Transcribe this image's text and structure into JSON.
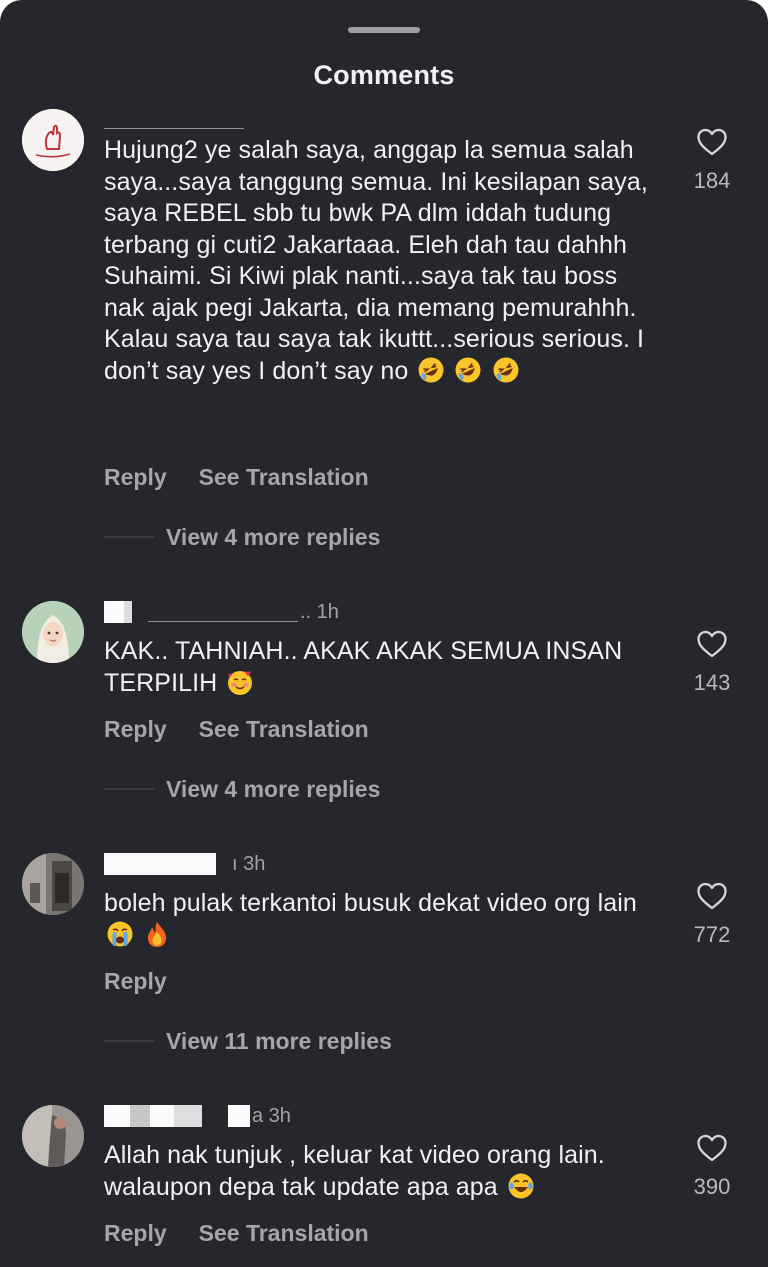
{
  "header": {
    "title": "Comments"
  },
  "comments": [
    {
      "time": "",
      "text": "Hujung2 ye salah saya, anggap la semua salah saya...saya tanggung semua. Ini kesilapan saya, saya REBEL sbb tu bwk PA dlm iddah tudung terbang gi cuti2 Jakartaaa. Eleh dah tau dahhh Suhaimi. Si Kiwi plak nanti...saya tak tau boss nak ajak pegi Jakarta, dia memang pemurahhh. Kalau saya tau saya tak ikuttt...serious serious. I don’t say yes I don’t say no",
      "emojis": [
        "rolling-laughing-emoji",
        "rolling-laughing-emoji",
        "rolling-laughing-emoji"
      ],
      "likes": "184",
      "reply_label": "Reply",
      "translate_label": "See Translation",
      "view_replies": "View 4 more replies"
    },
    {
      "username_visible": ".. 1h",
      "text": "KAK.. TAHNIAH.. AKAK AKAK SEMUA INSAN TERPILIH",
      "emojis": [
        "smiling-hearts-emoji"
      ],
      "likes": "143",
      "reply_label": "Reply",
      "translate_label": "See Translation",
      "view_replies": "View 4 more replies"
    },
    {
      "username_visible": "ı 3h",
      "text": "boleh pulak terkantoi busuk dekat video org lain",
      "emojis": [
        "loudly-crying-emoji",
        "fire-emoji"
      ],
      "likes": "772",
      "reply_label": "Reply",
      "view_replies": "View 11 more replies"
    },
    {
      "username_visible": "a 3h",
      "text": "Allah nak tunjuk , keluar kat video orang lain. walaupon depa tak update apa apa",
      "emojis": [
        "tears-of-joy-emoji"
      ],
      "likes": "390",
      "reply_label": "Reply",
      "translate_label": "See Translation"
    }
  ]
}
